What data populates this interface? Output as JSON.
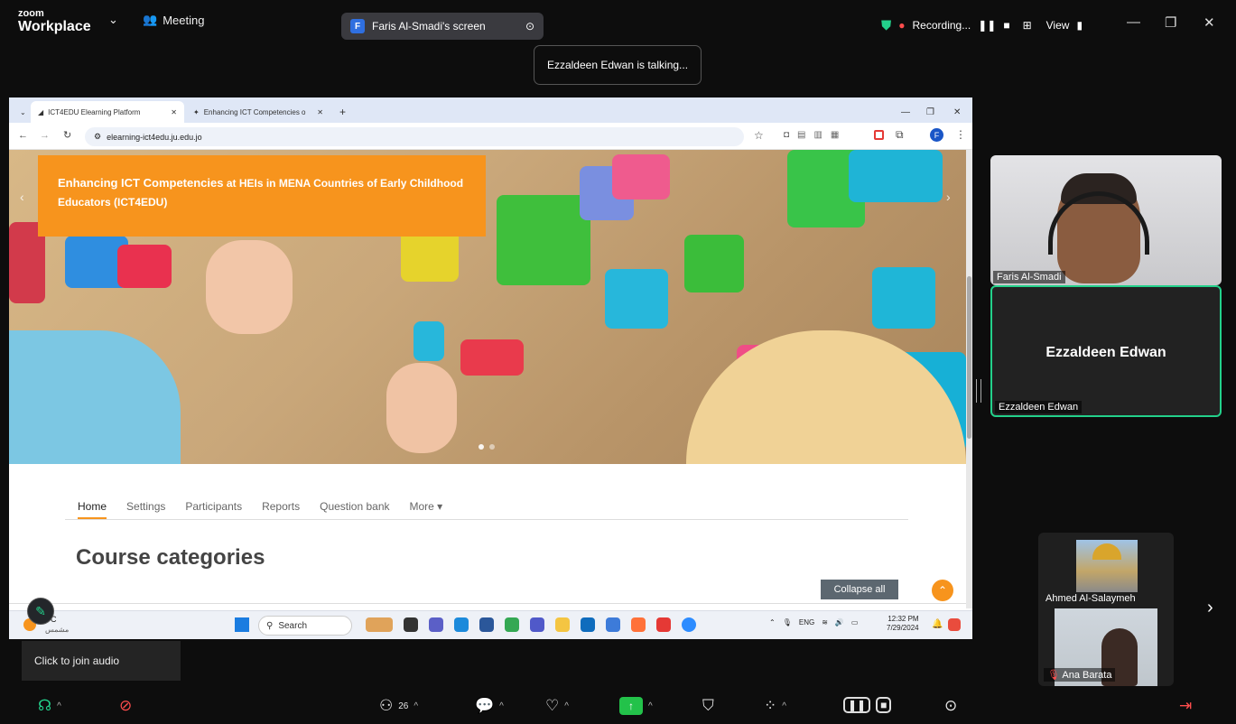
{
  "zoom": {
    "logo_top": "zoom",
    "logo_bottom": "Workplace",
    "meeting_label": "Meeting",
    "share_pill_badge": "F",
    "share_pill_label": "Faris Al-Smadi's screen",
    "talking_toast": "Ezzaldeen Edwan is talking...",
    "recording_label": "Recording...",
    "view_label": "View"
  },
  "browser": {
    "tabs": [
      {
        "label": "ICT4EDU Elearning Platform"
      },
      {
        "label": "Enhancing ICT Competencies o"
      }
    ],
    "url": "elearning-ict4edu.ju.edu.jo",
    "profile_badge": "F"
  },
  "site": {
    "banner_title_bold": "Enhancing ICT Competencies",
    "banner_title_rest": "at HEIs in MENA Countries of Early Childhood",
    "banner_title_line2": "Educators (ICT4EDU)",
    "nav": [
      "Home",
      "Settings",
      "Participants",
      "Reports",
      "Question bank",
      "More ▾"
    ],
    "course_title": "Course categories",
    "collapse_label": "Collapse all"
  },
  "taskbar": {
    "search_label": "Search",
    "lang": "ENG",
    "time": "12:32 PM",
    "date": "7/29/2024",
    "weather_letter": "C",
    "weather_text": "مشمس"
  },
  "participants": {
    "p1": "Faris Al-Smadi",
    "p2_big": "Ezzaldeen Edwan",
    "p2_tag": "Ezzaldeen Edwan",
    "p3": "Ahmed Al-Salaymeh",
    "p4": "Ana Barata"
  },
  "bottom": {
    "audio_tip": "Click to join audio",
    "participants_count": "26"
  },
  "colors": {
    "accent": "#f7941d",
    "active_speaker": "#23d18b",
    "share_green": "#23c24a"
  }
}
